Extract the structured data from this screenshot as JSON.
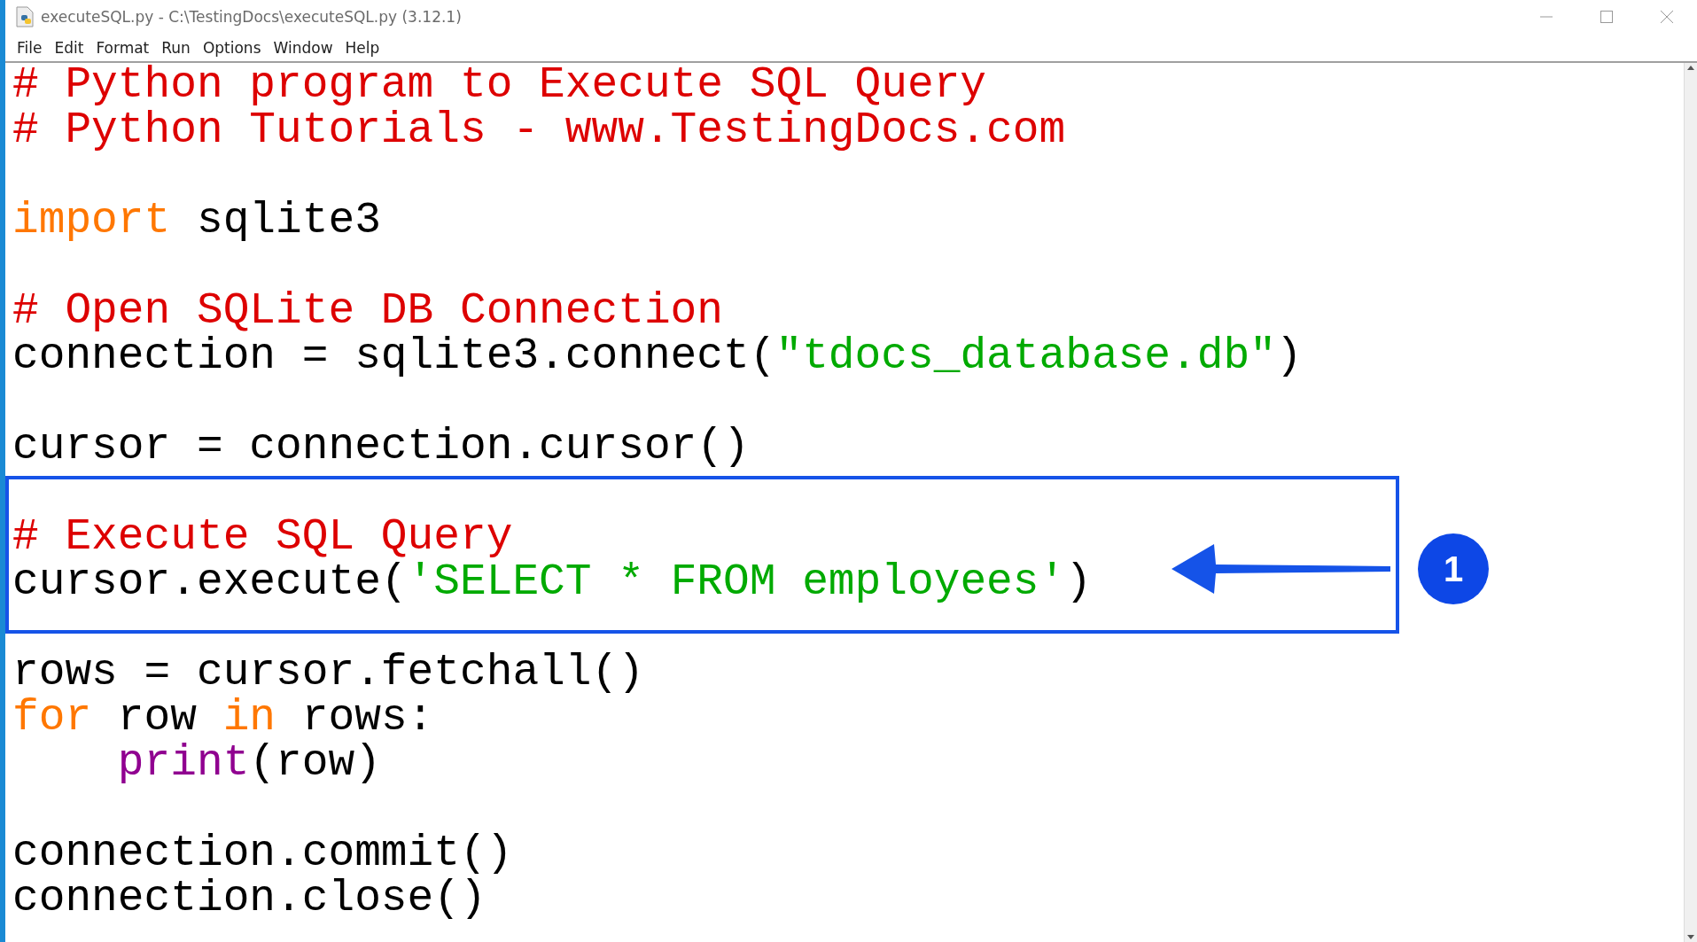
{
  "window": {
    "title": "executeSQL.py - C:\\TestingDocs\\executeSQL.py (3.12.1)"
  },
  "menu": [
    "File",
    "Edit",
    "Format",
    "Run",
    "Options",
    "Window",
    "Help"
  ],
  "editor": {
    "lines": [
      {
        "kind": "code",
        "tokens": [
          {
            "kind": "comment",
            "text": "# Python program to Execute SQL Query"
          }
        ]
      },
      {
        "kind": "code",
        "tokens": [
          {
            "kind": "comment",
            "text": "# Python Tutorials - www.TestingDocs.com"
          }
        ]
      },
      {
        "kind": "blank"
      },
      {
        "kind": "code",
        "tokens": [
          {
            "kind": "keyword",
            "text": "import"
          },
          {
            "kind": "plain",
            "text": " sqlite3"
          }
        ]
      },
      {
        "kind": "blank"
      },
      {
        "kind": "code",
        "tokens": [
          {
            "kind": "comment",
            "text": "# Open SQLite DB Connection"
          }
        ]
      },
      {
        "kind": "code",
        "tokens": [
          {
            "kind": "plain",
            "text": "connection = sqlite3.connect("
          },
          {
            "kind": "string",
            "text": "\"tdocs_database.db\""
          },
          {
            "kind": "plain",
            "text": ")"
          }
        ]
      },
      {
        "kind": "blank"
      },
      {
        "kind": "code",
        "tokens": [
          {
            "kind": "plain",
            "text": "cursor = connection.cursor()"
          }
        ]
      },
      {
        "kind": "blank"
      },
      {
        "kind": "code",
        "tokens": [
          {
            "kind": "comment",
            "text": "# Execute SQL Query"
          }
        ]
      },
      {
        "kind": "code",
        "tokens": [
          {
            "kind": "plain",
            "text": "cursor.execute("
          },
          {
            "kind": "string",
            "text": "'SELECT * FROM employees'"
          },
          {
            "kind": "plain",
            "text": ")"
          }
        ]
      },
      {
        "kind": "blank"
      },
      {
        "kind": "code",
        "tokens": [
          {
            "kind": "plain",
            "text": "rows = cursor.fetchall()"
          }
        ]
      },
      {
        "kind": "code",
        "tokens": [
          {
            "kind": "keyword",
            "text": "for"
          },
          {
            "kind": "plain",
            "text": " row "
          },
          {
            "kind": "keyword",
            "text": "in"
          },
          {
            "kind": "plain",
            "text": " rows:"
          }
        ]
      },
      {
        "kind": "code",
        "tokens": [
          {
            "kind": "builtin",
            "text": "    print"
          },
          {
            "kind": "plain",
            "text": "(row)"
          }
        ]
      },
      {
        "kind": "blank"
      },
      {
        "kind": "code",
        "tokens": [
          {
            "kind": "plain",
            "text": "connection.commit()"
          }
        ]
      },
      {
        "kind": "code",
        "tokens": [
          {
            "kind": "plain",
            "text": "connection.close()"
          }
        ]
      }
    ]
  },
  "callout": {
    "label": "1"
  }
}
